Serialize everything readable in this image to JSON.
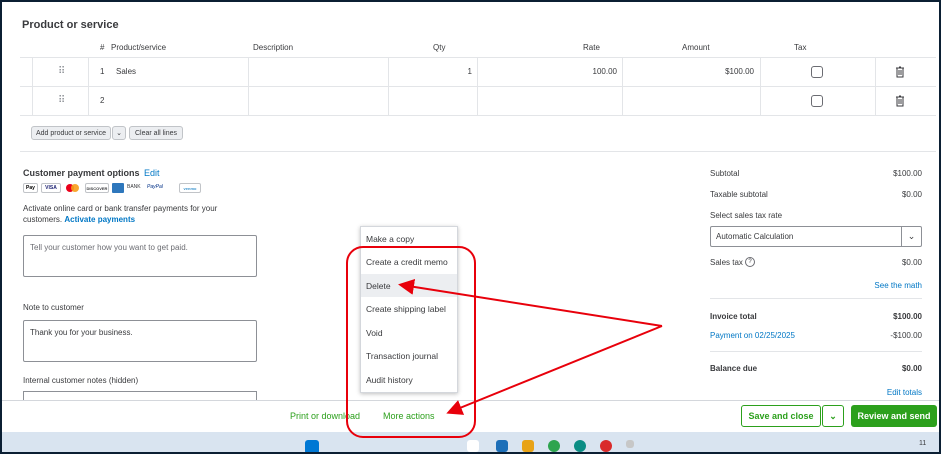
{
  "section_title": "Product or service",
  "table": {
    "headers": {
      "num": "#",
      "product": "Product/service",
      "description": "Description",
      "qty": "Qty",
      "rate": "Rate",
      "amount": "Amount",
      "tax": "Tax"
    },
    "rows": [
      {
        "num": "1",
        "product": "Sales",
        "description": "",
        "qty": "1",
        "rate": "100.00",
        "amount": "$100.00"
      },
      {
        "num": "2",
        "product": "",
        "description": "",
        "qty": "",
        "rate": "",
        "amount": ""
      }
    ]
  },
  "line_actions": {
    "add": "Add product or service",
    "clear": "Clear all lines"
  },
  "payment": {
    "title": "Customer payment options",
    "edit": "Edit",
    "icons": [
      "Pay",
      "VISA",
      "",
      "DISCOVER",
      "",
      "BANK",
      "PayPal",
      "venmo"
    ],
    "text": "Activate online card or bank transfer payments for your customers.",
    "activate": "Activate payments",
    "placeholder": "Tell your customer how you want to get paid."
  },
  "note": {
    "label": "Note to customer",
    "value": "Thank you for your business."
  },
  "internal": {
    "label": "Internal customer notes (hidden)"
  },
  "menu": {
    "items": [
      "Make a copy",
      "Create a credit memo",
      "Delete",
      "Create shipping label",
      "Void",
      "Transaction journal",
      "Audit history"
    ],
    "highlighted_index": 2
  },
  "totals": {
    "subtotal_label": "Subtotal",
    "subtotal": "$100.00",
    "taxable_label": "Taxable subtotal",
    "taxable": "$0.00",
    "rate_label": "Select sales tax rate",
    "rate_value": "Automatic Calculation",
    "sales_tax_label": "Sales tax",
    "sales_tax": "$0.00",
    "see_math": "See the math",
    "invoice_total_label": "Invoice total",
    "invoice_total": "$100.00",
    "payment_label": "Payment on 02/25/2025",
    "payment": "-$100.00",
    "balance_label": "Balance due",
    "balance": "$0.00",
    "edit_totals": "Edit totals"
  },
  "footer": {
    "print": "Print or download",
    "more": "More actions",
    "save_close": "Save and close",
    "review_send": "Review and send"
  },
  "colors": {
    "accent_green": "#2ca01c",
    "link_blue": "#0077c5",
    "annotation_red": "#e8000b"
  },
  "taskbar": {
    "clock_fragment": "11"
  }
}
